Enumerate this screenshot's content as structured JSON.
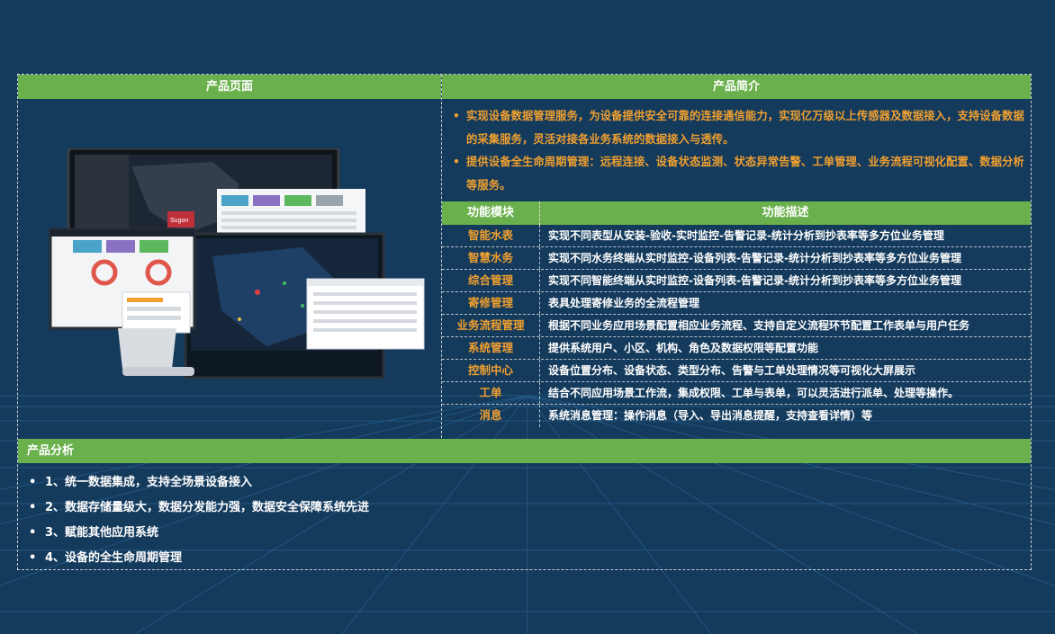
{
  "header": {
    "left_title": "产品页面",
    "right_title": "产品简介"
  },
  "intro": [
    "实现设备数据管理服务，为设备提供安全可靠的连接通信能力，实现亿万级以上传感器及数据接入，支持设备数据的采集服务，灵活对接各业务系统的数据接入与透传。",
    "提供设备全生命周期管理：远程连接、设备状态监测、状态异常告警、工单管理、业务流程可视化配置、数据分析等服务。"
  ],
  "table": {
    "headers": [
      "功能模块",
      "功能描述"
    ],
    "rows": [
      {
        "module": "智能水表",
        "desc": "实现不同表型从安装-验收-实时监控-告警记录-统计分析到抄表率等多方位业务管理"
      },
      {
        "module": "智慧水务",
        "desc": "实现不同水务终端从实时监控-设备列表-告警记录-统计分析到抄表率等多方位业务管理"
      },
      {
        "module": "综合管理",
        "desc": "实现不同智能终端从实时监控-设备列表-告警记录-统计分析到抄表率等多方位业务管理"
      },
      {
        "module": "寄修管理",
        "desc": "表具处理寄修业务的全流程管理"
      },
      {
        "module": "业务流程管理",
        "desc": "根据不同业务应用场景配置相应业务流程、支持自定义流程环节配置工作表单与用户任务"
      },
      {
        "module": "系统管理",
        "desc": "提供系统用户、小区、机构、角色及数据权限等配置功能"
      },
      {
        "module": "控制中心",
        "desc": "设备位置分布、设备状态、类型分布、告警与工单处理情况等可视化大屏展示"
      },
      {
        "module": "工单",
        "desc": "结合不同应用场景工作流，集成权限、工单与表单，可以灵活进行派单、处理等操作。"
      },
      {
        "module": "消息",
        "desc": "系统消息管理：操作消息（导入、导出消息提醒，支持查看详情）等"
      }
    ]
  },
  "analysis": {
    "title": "产品分析",
    "items": [
      "1、统一数据集成，支持全场景设备接入",
      "2、数据存储量级大，数据分发能力强，数据安全保障系统先进",
      "3、赋能其他应用系统",
      "4、设备的全生命周期管理"
    ]
  },
  "product_image": {
    "logo_text": "Sugon"
  },
  "colors": {
    "background": "#143a5c",
    "header_green": "#6ab04c",
    "accent_orange": "#f0a030"
  }
}
